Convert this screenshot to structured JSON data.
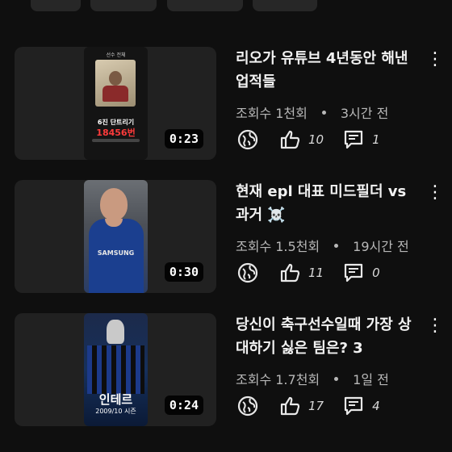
{
  "videos": [
    {
      "title": "리오가 유튜브 4년동안 해낸 업적들",
      "views": "조회수 1천회",
      "time": "3시간 전",
      "likes": "10",
      "comments": "1",
      "duration": "0:23",
      "thumb": {
        "header": "선수 전체",
        "caption": "6진 단트리기",
        "amount": "18456번"
      }
    },
    {
      "title": "현재 epl 대표 미드필더 vs 과거 ☠️",
      "views": "조회수 1.5천회",
      "time": "19시간 전",
      "likes": "11",
      "comments": "0",
      "duration": "0:30",
      "thumb": {
        "shirt": "SAMSUNG"
      }
    },
    {
      "title": "당신이 축구선수일때 가장 상대하기 싫은 팀은? 3",
      "views": "조회수 1.7천회",
      "time": "1일 전",
      "likes": "17",
      "comments": "4",
      "duration": "0:24",
      "thumb": {
        "caption": "인테르",
        "sub": "2009/10 시즌"
      }
    }
  ],
  "icons": {
    "share": "globe-icon",
    "like": "thumbs-up-icon",
    "comment": "comment-icon",
    "menu": "more-vert-icon"
  },
  "colors": {
    "background": "#0f0f0f",
    "card": "#212121",
    "meta": "#b8b8b8"
  }
}
